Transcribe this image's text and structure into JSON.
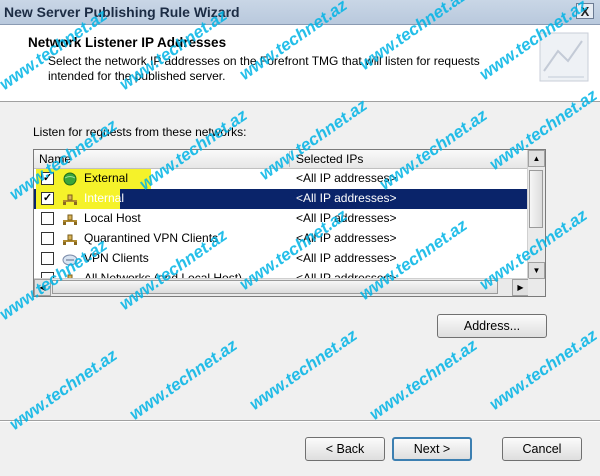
{
  "window": {
    "title": "New Server Publishing Rule Wizard",
    "close_label": "X"
  },
  "header": {
    "title": "Network Listener IP Addresses",
    "description": "Select the network IP addresses on the Forefront TMG that will listen for requests intended for the published server."
  },
  "listen_label": "Listen for requests from these networks:",
  "listview": {
    "columns": [
      "Name",
      "Selected IPs"
    ],
    "rows": [
      {
        "name": "External",
        "ips": "<All IP addresses>",
        "checked": true,
        "selected": false,
        "icon": "globe-icon"
      },
      {
        "name": "Internal",
        "ips": "<All IP addresses>",
        "checked": true,
        "selected": true,
        "icon": "network-icon"
      },
      {
        "name": "Local Host",
        "ips": "<All IP addresses>",
        "checked": false,
        "selected": false,
        "icon": "network-icon"
      },
      {
        "name": "Quarantined VPN Clients",
        "ips": "<All IP addresses>",
        "checked": false,
        "selected": false,
        "icon": "network-icon"
      },
      {
        "name": "VPN Clients",
        "ips": "<All IP addresses>",
        "checked": false,
        "selected": false,
        "icon": "vpn-clients-icon"
      },
      {
        "name": "All Networks (and Local Host)",
        "ips": "<All IP addresses>",
        "checked": false,
        "selected": false,
        "icon": "network-icon"
      }
    ]
  },
  "buttons": {
    "address": "Address...",
    "back": "< Back",
    "next": "Next >",
    "cancel": "Cancel"
  },
  "watermark": "www.technet.az",
  "colors": {
    "selection": "#0a246a",
    "highlight": "#f5f22a",
    "watermark": "#00b4e6"
  }
}
